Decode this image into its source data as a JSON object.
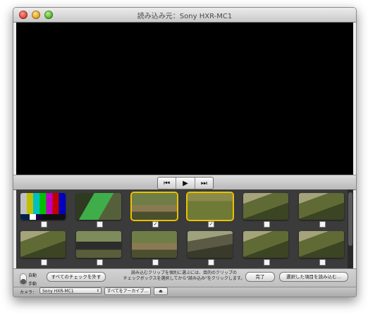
{
  "window": {
    "title": "読み込み元：Sony HXR-MC1"
  },
  "controls": {
    "prev_icon": "skip-back-icon",
    "play_icon": "play-icon",
    "next_icon": "skip-forward-icon",
    "prev_glyph": "⏮",
    "play_glyph": "▶",
    "next_glyph": "⏭"
  },
  "thumbnails": [
    {
      "kind": "color-bars",
      "checked": false
    },
    {
      "kind": "green-screen",
      "checked": false
    },
    {
      "kind": "trail",
      "checked": true,
      "selected": true
    },
    {
      "kind": "grass",
      "checked": true,
      "selected": true
    },
    {
      "kind": "forest",
      "checked": false
    },
    {
      "kind": "forest",
      "checked": false
    },
    {
      "kind": "forest",
      "checked": false
    },
    {
      "kind": "car",
      "checked": false
    },
    {
      "kind": "trail",
      "checked": false
    },
    {
      "kind": "rocks",
      "checked": false
    },
    {
      "kind": "forest",
      "checked": false
    },
    {
      "kind": "forest",
      "checked": false
    }
  ],
  "checkbox_mark": "✓",
  "import_mode": {
    "auto_label": "自動",
    "manual_label": "手動"
  },
  "buttons": {
    "uncheck_all": "すべてのチェックを外す",
    "done": "完了",
    "import_selected": "選択した項目を読み込む…",
    "archive_all": "すべてをアーカイブ…",
    "eject_glyph": "⏏"
  },
  "instructions": {
    "line1": "読み込むクリップを個別に選ぶには、目的のクリップの",
    "line2": "チェックボックスを選択してから\"読み込み\"をクリックします。"
  },
  "camera": {
    "label": "カメラ：",
    "selected": "Sony HXR-MC1",
    "select_arrow": "⇕"
  },
  "colors": {
    "selection": "#e8c200",
    "gallery_bg": "#3b3b3b"
  }
}
